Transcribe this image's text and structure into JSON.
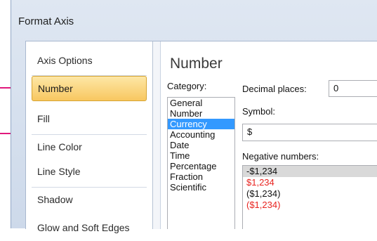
{
  "window": {
    "title": "Format Axis"
  },
  "nav": {
    "items": [
      {
        "label": "Axis Options",
        "active": false
      },
      {
        "label": "Number",
        "active": true
      },
      {
        "label": "Fill",
        "active": false
      },
      {
        "label": "Line Color",
        "active": false
      },
      {
        "label": "Line Style",
        "active": false
      },
      {
        "label": "Shadow",
        "active": false
      },
      {
        "label": "Glow and Soft Edges",
        "active": false
      }
    ]
  },
  "panel": {
    "heading": "Number",
    "category_label": "Category:",
    "categories": [
      "General",
      "Number",
      "Currency",
      "Accounting",
      "Date",
      "Time",
      "Percentage",
      "Fraction",
      "Scientific"
    ],
    "selected_category": "Currency",
    "decimal_label": "Decimal places:",
    "decimal_value": "0",
    "symbol_label": "Symbol:",
    "symbol_value": "$",
    "negative_label": "Negative numbers:",
    "negative_options": [
      {
        "text": "-$1,234",
        "color": "#111111"
      },
      {
        "text": "$1,234",
        "color": "#e8231f"
      },
      {
        "text": "($1,234)",
        "color": "#111111"
      },
      {
        "text": "($1,234)",
        "color": "#e8231f"
      }
    ]
  },
  "colors": {
    "callout": "#e0197d",
    "selection": "#3399ff",
    "active_tab": "#f8c760"
  }
}
